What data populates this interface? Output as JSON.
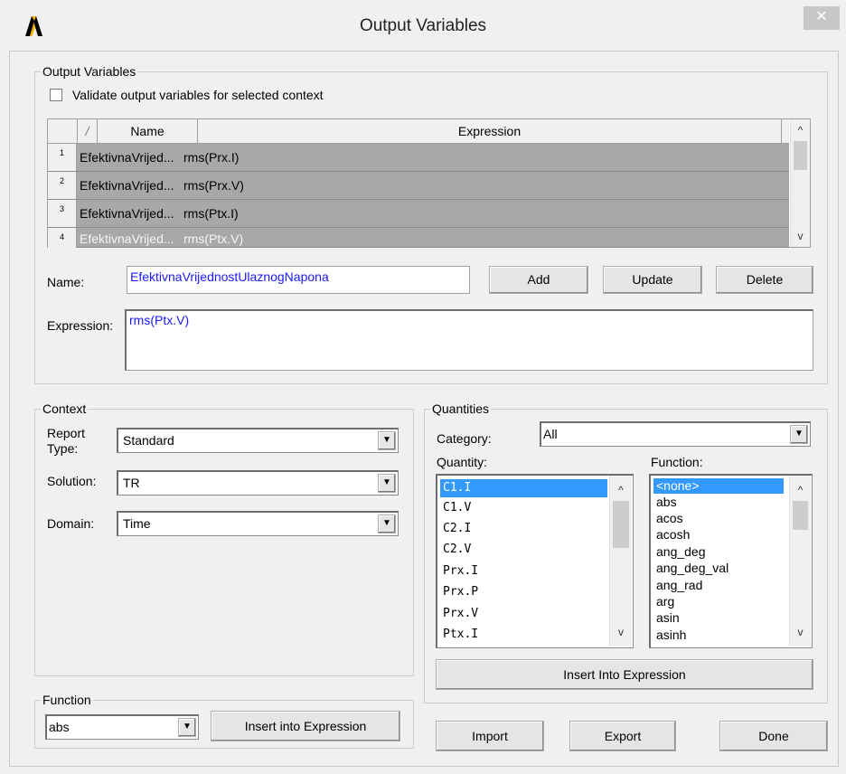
{
  "window": {
    "title": "Output Variables",
    "close_glyph": "✕"
  },
  "output_variables": {
    "group_label": "Output Variables",
    "validate_label": "Validate output variables for selected context",
    "table": {
      "sort_glyph": "/",
      "headers": [
        "Name",
        "Expression"
      ],
      "rows": [
        {
          "num": "1",
          "name": "EfektivnaVrijed...",
          "expression": "rms(Prx.I)"
        },
        {
          "num": "2",
          "name": "EfektivnaVrijed...",
          "expression": "rms(Prx.V)"
        },
        {
          "num": "3",
          "name": "EfektivnaVrijed...",
          "expression": "rms(Ptx.I)"
        },
        {
          "num": "4",
          "name": "EfektivnaVrijed...",
          "expression": "rms(Ptx.V)"
        }
      ]
    },
    "name_label": "Name:",
    "name_value": "EfektivnaVrijednostUlaznogNapona",
    "add_label": "Add",
    "update_label": "Update",
    "delete_label": "Delete",
    "expression_label": "Expression:",
    "expression_value": "rms(Ptx.V)"
  },
  "context": {
    "group_label": "Context",
    "report_type_label": "Report Type:",
    "report_type_value": "Standard",
    "solution_label": "Solution:",
    "solution_value": "TR",
    "domain_label": "Domain:",
    "domain_value": "Time"
  },
  "function_group": {
    "group_label": "Function",
    "value": "abs",
    "insert_label": "Insert into Expression"
  },
  "quantities": {
    "group_label": "Quantities",
    "category_label": "Category:",
    "category_value": "All",
    "quantity_label": "Quantity:",
    "function_label": "Function:",
    "quantity_items": [
      "C1.I",
      "C1.V",
      "C2.I",
      "C2.V",
      "Prx.I",
      "Prx.P",
      "Prx.V",
      "Ptx.I"
    ],
    "function_items": [
      "<none>",
      "abs",
      "acos",
      "acosh",
      "ang_deg",
      "ang_deg_val",
      "ang_rad",
      "arg",
      "asin",
      "asinh"
    ],
    "insert_label": "Insert Into Expression"
  },
  "footer": {
    "import_label": "Import",
    "export_label": "Export",
    "done_label": "Done"
  },
  "icons": {
    "scroll_up": "^",
    "scroll_down": "v",
    "drop": "▼"
  },
  "colors": {
    "selection": "#3399ff",
    "field_text": "#1a1aff",
    "row_selected_bg": "#a8a8a8"
  }
}
